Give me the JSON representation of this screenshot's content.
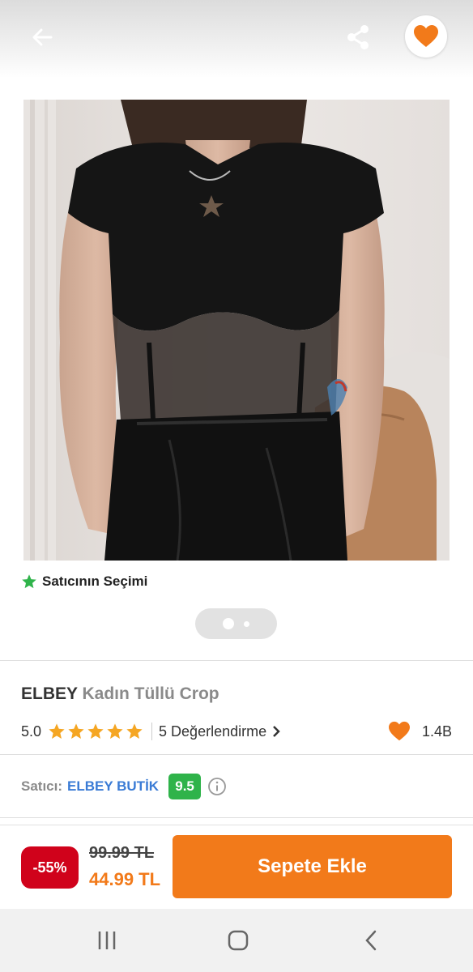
{
  "header": {
    "back_icon": "arrow-left-icon",
    "share_icon": "share-icon",
    "favorite_icon": "heart-icon"
  },
  "gallery": {
    "seller_choice_label": "Satıcının Seçimi",
    "page_count": 2,
    "current_page": 1
  },
  "product": {
    "brand": "ELBEY",
    "name": "Kadın Tüllü Crop",
    "rating": "5.0",
    "stars": 5,
    "reviews_label": "5 Değerlendirme",
    "favorites_count": "1.4B"
  },
  "seller": {
    "label": "Satıcı:",
    "name": "ELBEY BUTİK",
    "score": "9.5"
  },
  "purchase": {
    "discount": "-55%",
    "old_price": "99.99 TL",
    "new_price": "44.99 TL",
    "add_to_cart_label": "Sepete Ekle"
  },
  "colors": {
    "accent": "#f27a1a",
    "discount": "#d0021b",
    "seller_link": "#3a7bd5",
    "score_green": "#2fb34a",
    "star": "#f5a623",
    "choice_star": "#2fb34a"
  }
}
